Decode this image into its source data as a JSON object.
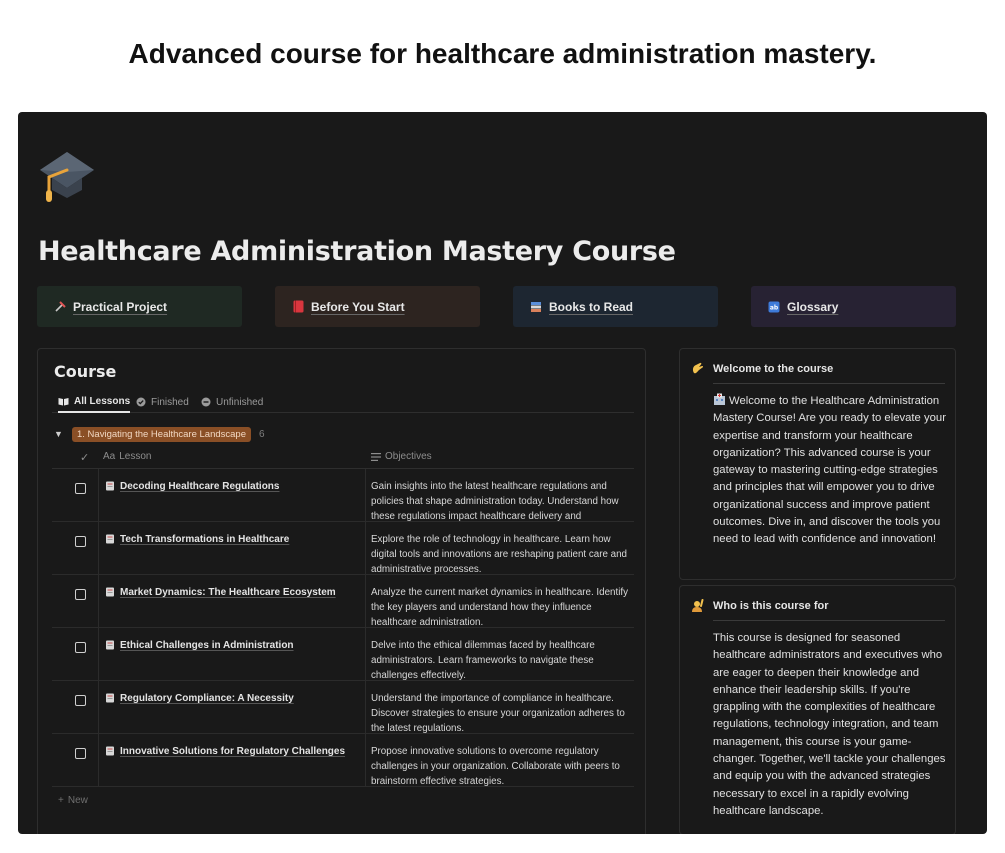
{
  "headline": "Advanced course for healthcare administration mastery.",
  "page": {
    "icon": "graduation-cap-icon",
    "title": "Healthcare Administration Mastery Course"
  },
  "quick_links": [
    {
      "label": "Practical Project",
      "icon": "hammer-pick-icon",
      "bg": "#1f2923"
    },
    {
      "label": "Before You Start",
      "icon": "red-book-icon",
      "bg": "#2d2420"
    },
    {
      "label": "Books to Read",
      "icon": "books-icon",
      "bg": "#1d2631"
    },
    {
      "label": "Glossary",
      "icon": "abc-icon",
      "bg": "#272233"
    }
  ],
  "course": {
    "title": "Course",
    "tabs": [
      {
        "label": "All Lessons",
        "icon": "open-book-icon",
        "active": true
      },
      {
        "label": "Finished",
        "icon": "check-circle-icon",
        "active": false
      },
      {
        "label": "Unfinished",
        "icon": "minus-circle-icon",
        "active": false
      }
    ],
    "group": {
      "label": "1. Navigating the Healthcare Landscape",
      "count": "6"
    },
    "columns": {
      "check": "✓",
      "lesson_prefix": "Aa",
      "lesson": "Lesson",
      "objectives": "Objectives"
    },
    "rows": [
      {
        "lesson": "Decoding Healthcare Regulations",
        "objectives": "Gain insights into the latest healthcare regulations and policies that shape administration today. Understand how these regulations impact healthcare delivery and administration."
      },
      {
        "lesson": "Tech Transformations in Healthcare",
        "objectives": "Explore the role of technology in healthcare. Learn how digital tools and innovations are reshaping patient care and administrative processes."
      },
      {
        "lesson": "Market Dynamics: The Healthcare Ecosystem",
        "objectives": "Analyze the current market dynamics in healthcare. Identify the key players and understand how they influence healthcare administration."
      },
      {
        "lesson": "Ethical Challenges in Administration",
        "objectives": "Delve into the ethical dilemmas faced by healthcare administrators. Learn frameworks to navigate these challenges effectively."
      },
      {
        "lesson": "Regulatory Compliance: A Necessity",
        "objectives": "Understand the importance of compliance in healthcare. Discover strategies to ensure your organization adheres to the latest regulations."
      },
      {
        "lesson": "Innovative Solutions for Regulatory Challenges",
        "objectives": "Propose innovative solutions to overcome regulatory challenges in your organization. Collaborate with peers to brainstorm effective strategies."
      }
    ],
    "new_label": "New"
  },
  "welcome": {
    "icon": "waving-hand-icon",
    "title": "Welcome to the course",
    "body_icon": "hospital-icon",
    "body": "Welcome to the Healthcare Administration Mastery Course! Are you ready to elevate your expertise and transform your healthcare organization? This advanced course is your gateway to mastering cutting-edge strategies and principles that will empower you to drive organizational success and improve patient outcomes. Dive in, and discover the tools you need to lead with confidence and innovation!"
  },
  "audience": {
    "icon": "person-raising-hand-icon",
    "title": "Who is this course for",
    "body": "This course is designed for seasoned healthcare administrators and executives who are eager to deepen their knowledge and enhance their leadership skills. If you're grappling with the complexities of healthcare regulations, technology integration, and team management, this course is your game-changer. Together, we'll tackle your challenges and equip you with the advanced strategies necessary to excel in a rapidly evolving healthcare landscape."
  }
}
